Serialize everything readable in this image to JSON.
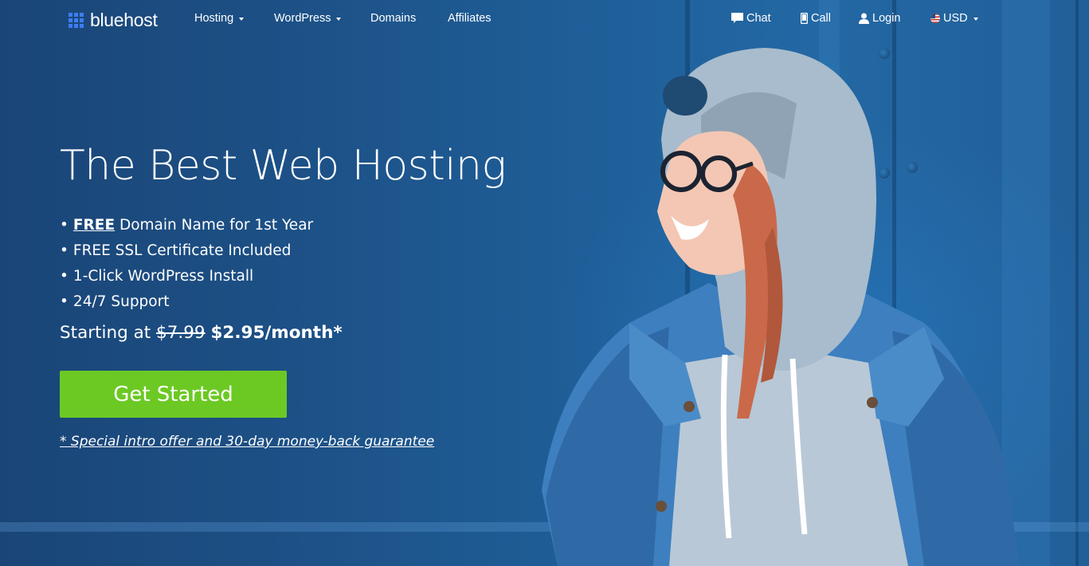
{
  "brand": {
    "name": "bluehost",
    "color": "#3d7cf2"
  },
  "nav": {
    "hosting": "Hosting",
    "wordpress": "WordPress",
    "domains": "Domains",
    "affiliates": "Affiliates",
    "chat": "Chat",
    "call": "Call",
    "login": "Login",
    "currency": "USD"
  },
  "hero": {
    "headline": "The Best Web Hosting",
    "features": [
      {
        "strong": "FREE",
        "text": " Domain Name for 1st Year"
      },
      {
        "text": "FREE SSL Certificate Included"
      },
      {
        "text": "1-Click WordPress Install"
      },
      {
        "text": "24/7 Support"
      }
    ],
    "bullet": "•",
    "price_prefix": "Starting at ",
    "price_old": "$7.99",
    "price_new": "$2.95/month*",
    "cta_label": "Get Started",
    "cta_color": "#6cc924",
    "guarantee": "* Special intro offer and 30-day money-back guarantee"
  }
}
